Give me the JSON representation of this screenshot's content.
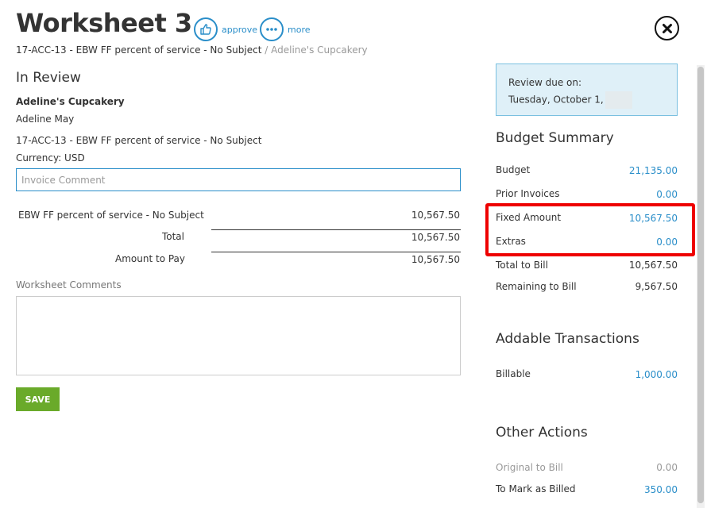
{
  "header": {
    "title": "Worksheet 3",
    "approve_label": "approve",
    "more_label": "more"
  },
  "breadcrumb": {
    "item1": "17-ACC-13 - EBW FF percent of service - No Subject",
    "separator": "/",
    "item2": "Adeline's Cupcakery"
  },
  "main": {
    "status_heading": "In Review",
    "client_name": "Adeline's Cupcakery",
    "contact_name": "Adeline May",
    "job_name": "17-ACC-13 - EBW FF percent of service - No Subject",
    "currency": "Currency: USD",
    "invoice_comment_placeholder": "Invoice Comment",
    "line_items": [
      {
        "label": "EBW FF percent of service - No Subject",
        "amount": "10,567.50"
      }
    ],
    "total_label": "Total",
    "total_value": "10,567.50",
    "amount_to_pay_label": "Amount to Pay",
    "amount_to_pay_value": "10,567.50",
    "worksheet_comments_label": "Worksheet Comments",
    "save_label": "SAVE"
  },
  "sidebar": {
    "review_due_label": "Review due on:",
    "review_due_date": "Tuesday, October 1,",
    "budget_summary_heading": "Budget Summary",
    "budget": [
      {
        "label": "Budget",
        "value": "21,135.00"
      },
      {
        "label": "Prior Invoices",
        "value": "0.00"
      },
      {
        "label": "Fixed Amount",
        "value": "10,567.50"
      },
      {
        "label": "Extras",
        "value": "0.00"
      },
      {
        "label": "Total to Bill",
        "value": "10,567.50"
      },
      {
        "label": "Remaining to Bill",
        "value": "9,567.50"
      }
    ],
    "addable_heading": "Addable Transactions",
    "addable": [
      {
        "label": "Billable",
        "value": "1,000.00"
      }
    ],
    "other_actions_heading": "Other Actions",
    "other_actions": [
      {
        "label": "Original to Bill",
        "value": "0.00"
      },
      {
        "label": "To Mark as Billed",
        "value": "350.00"
      }
    ]
  },
  "colors": {
    "accent": "#2a8ec9",
    "save_button": "#6aaa2a",
    "review_box_bg": "#dff0f8",
    "highlight": "#ee0000"
  },
  "icons": {
    "approve": "thumbs-up-icon",
    "more": "ellipsis-icon",
    "close": "close-icon"
  }
}
